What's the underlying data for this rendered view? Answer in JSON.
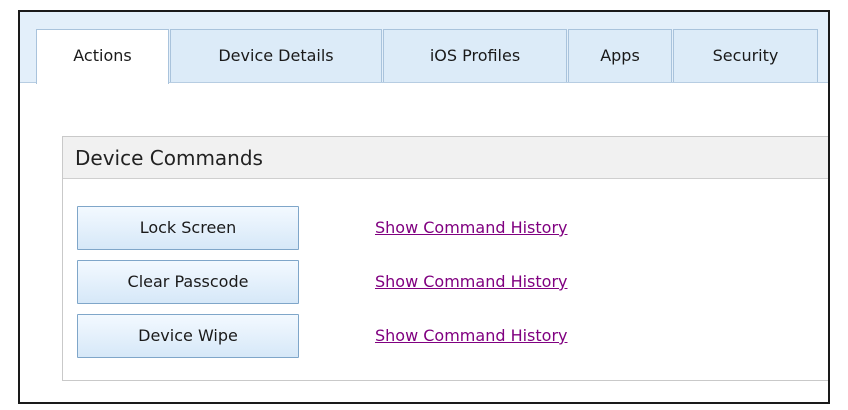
{
  "tabs": [
    {
      "label": "Actions",
      "active": true
    },
    {
      "label": "Device Details",
      "active": false
    },
    {
      "label": "iOS Profiles",
      "active": false
    },
    {
      "label": "Apps",
      "active": false
    },
    {
      "label": "Security",
      "active": false
    }
  ],
  "panel": {
    "title": "Device Commands",
    "commands": [
      {
        "button_label": "Lock Screen",
        "link_label": "Show Command History"
      },
      {
        "button_label": "Clear Passcode",
        "link_label": "Show Command History"
      },
      {
        "button_label": "Device Wipe",
        "link_label": "Show Command History"
      }
    ]
  },
  "colors": {
    "tab_strip": "#e3effa",
    "button_border": "#7fa6c9",
    "visited_link": "#800080",
    "panel_header": "#f1f1f1"
  }
}
